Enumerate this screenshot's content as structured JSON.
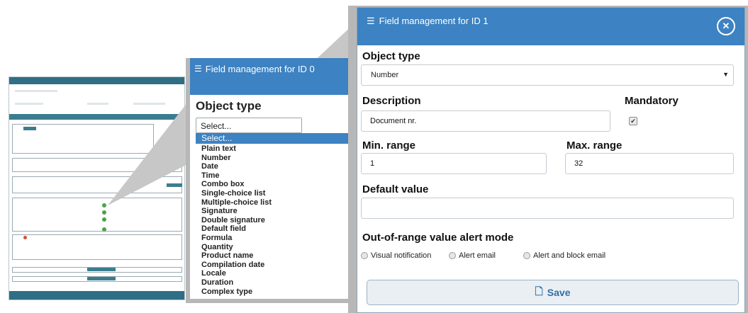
{
  "mid_panel": {
    "title": "Field management for ID 0",
    "object_type_label": "Object type",
    "selected_value": "Select...",
    "options": [
      "Select...",
      "Plain text",
      "Number",
      "Date",
      "Time",
      "Combo box",
      "Single-choice list",
      "Multiple-choice list",
      "Signature",
      "Double signature",
      "Default field",
      "Formula",
      "Quantity",
      "Product name",
      "Compilation date",
      "Locale",
      "Duration",
      "Complex type"
    ]
  },
  "modal": {
    "title": "Field management for ID 1",
    "close_icon": "close-icon",
    "object_type_label": "Object type",
    "object_type_value": "Number",
    "description_label": "Description",
    "description_value": "Document nr.",
    "mandatory_label": "Mandatory",
    "mandatory_checked": true,
    "min_range_label": "Min. range",
    "min_range_value": "1",
    "max_range_label": "Max. range",
    "max_range_value": "32",
    "default_value_label": "Default value",
    "default_value_value": "",
    "alert_mode_label": "Out-of-range value alert mode",
    "alert_options": [
      "Visual notification",
      "Alert email",
      "Alert and block email"
    ],
    "save_label": "Save"
  },
  "colors": {
    "header_blue": "#3d82c2",
    "callout_grey": "#b7b7b7",
    "save_text": "#2f6fa6"
  }
}
